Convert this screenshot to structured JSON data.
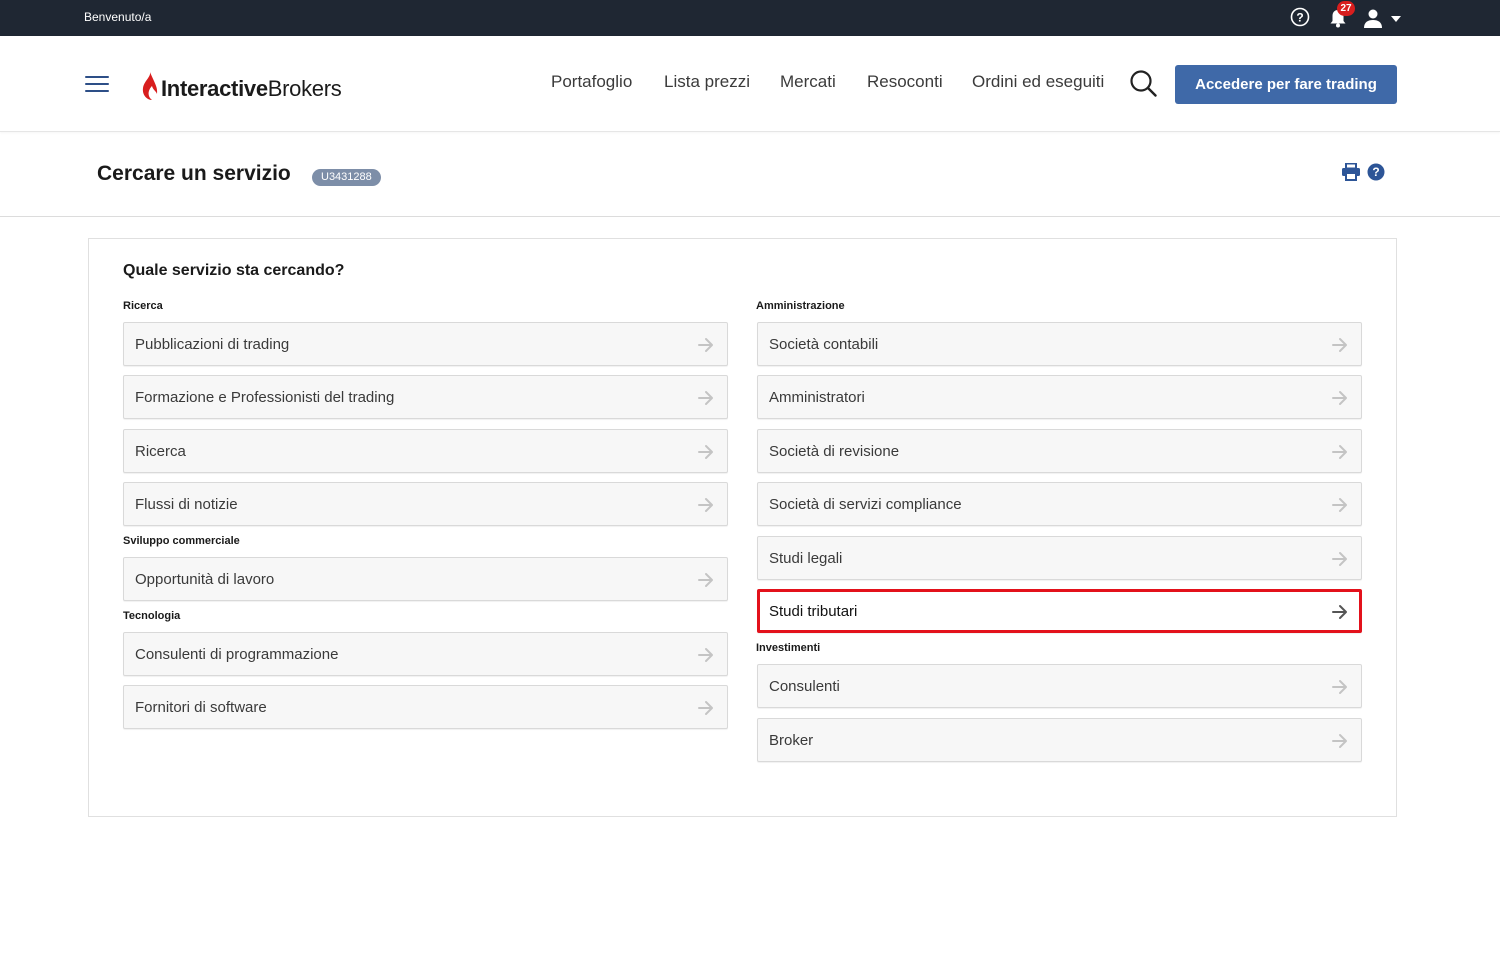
{
  "topbar": {
    "welcome": "Benvenuto/a",
    "notification_count": "27",
    "icons": [
      "help-circle-icon",
      "bell-icon",
      "user-icon",
      "caret-down-icon"
    ]
  },
  "header": {
    "brand_bold": "Interactive",
    "brand_light": "Brokers",
    "nav": [
      "Portafoglio",
      "Lista prezzi",
      "Mercati",
      "Resoconti",
      "Ordini ed eseguiti"
    ],
    "trade_button": "Accedere per fare trading",
    "icons": [
      "menu-icon",
      "logo-flame-icon",
      "search-icon"
    ]
  },
  "page": {
    "title": "Cercare un servizio",
    "account_id": "U3431288",
    "icons": [
      "print-icon",
      "help-icon"
    ]
  },
  "panel": {
    "title": "Quale servizio sta cercando?",
    "sections": {
      "ricerca": {
        "label": "Ricerca",
        "items": [
          "Pubblicazioni di trading",
          "Formazione e Professionisti del trading",
          "Ricerca",
          "Flussi di notizie"
        ]
      },
      "sviluppo": {
        "label": "Sviluppo commerciale",
        "items": [
          "Opportunità di lavoro"
        ]
      },
      "tecnologia": {
        "label": "Tecnologia",
        "items": [
          "Consulenti di programmazione",
          "Fornitori di software"
        ]
      },
      "amministrazione": {
        "label": "Amministrazione",
        "items": [
          "Società contabili",
          "Amministratori",
          "Società di revisione",
          "Società di servizi compliance",
          "Studi legali",
          "Studi tributari"
        ]
      },
      "investimenti": {
        "label": "Investimenti",
        "items": [
          "Consulenti",
          "Broker"
        ]
      }
    },
    "highlighted_item": "Studi tributari",
    "colors": {
      "accent": "#3f69a8",
      "highlight_border": "#e3111b",
      "topbar": "#1f2733",
      "badge": "#d81e1e"
    }
  }
}
